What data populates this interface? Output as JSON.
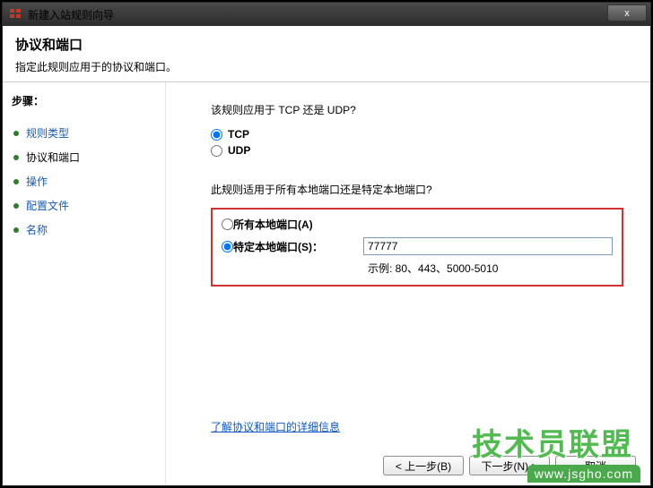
{
  "window": {
    "title": "新建入站规则向导",
    "close_label": "x"
  },
  "header": {
    "title": "协议和端口",
    "subtitle": "指定此规则应用于的协议和端口。"
  },
  "sidebar": {
    "steps_label": "步骤：",
    "items": [
      {
        "label": "规则类型",
        "state": "completed"
      },
      {
        "label": "协议和端口",
        "state": "current"
      },
      {
        "label": "操作",
        "state": "pending"
      },
      {
        "label": "配置文件",
        "state": "pending"
      },
      {
        "label": "名称",
        "state": "pending"
      }
    ]
  },
  "content": {
    "protocol_question": "该规则应用于 TCP 还是 UDP?",
    "tcp_label": "TCP",
    "udp_label": "UDP",
    "protocol_selected": "tcp",
    "port_question": "此规则适用于所有本地端口还是特定本地端口?",
    "all_ports_label": "所有本地端口(A)",
    "specific_ports_label": "特定本地端口(S)：",
    "port_scope_selected": "specific",
    "port_value": "77777",
    "port_example": "示例: 80、443、5000-5010",
    "learn_more": "了解协议和端口的详细信息"
  },
  "footer": {
    "back": "< 上一步(B)",
    "next": "下一步(N) >",
    "cancel": "取消"
  },
  "watermark": {
    "text1": "技术员联盟",
    "text2": "www.jsgho.com"
  }
}
